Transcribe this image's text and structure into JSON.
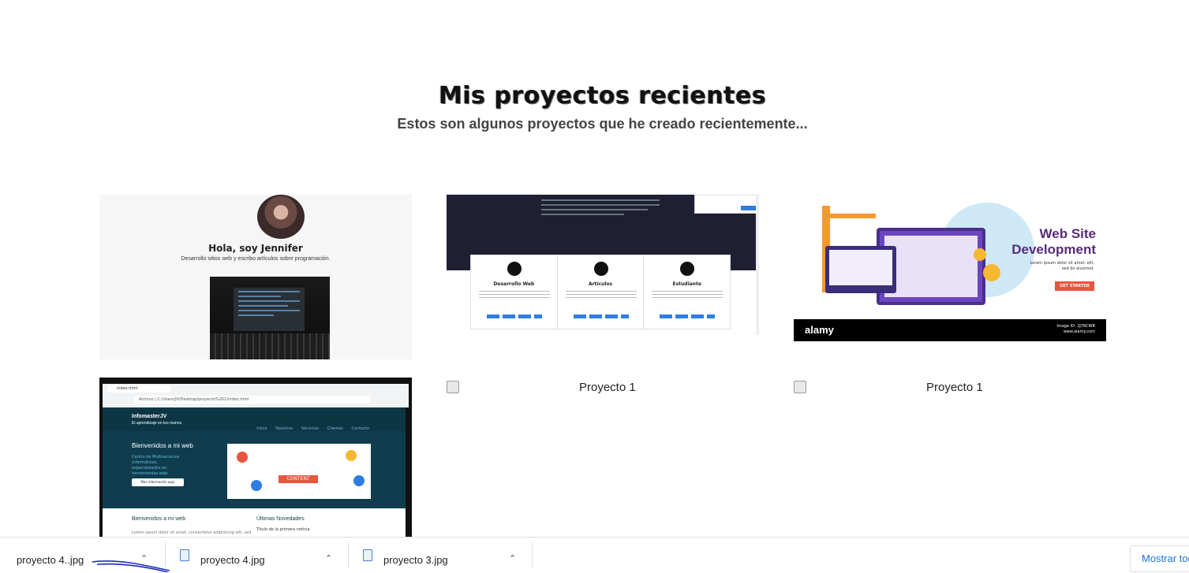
{
  "header": {
    "title": "Mis proyectos recientes",
    "subtitle": "Estos son algunos proyectos que he creado recientemente..."
  },
  "projects": [
    {
      "name": "project-1",
      "heading": "Hola, soy Jennifer",
      "text": "Desarrollo sitios web y escribo artículos sobre programación."
    },
    {
      "name": "project-2",
      "columns": [
        "Desarrollo Web",
        "Artículos",
        "Estudiante"
      ]
    },
    {
      "name": "project-3",
      "headline_1": "Web Site",
      "headline_2": "Development",
      "lorem": "Lorem ipsum dolor sit amet, elit, sed do eiusmod.",
      "cta": "GET STARTED",
      "brand": "alamy",
      "image_id": "Image ID: 2J7KCWR",
      "site": "www.alamy.com"
    },
    {
      "name": "project-4",
      "tab": "index.html",
      "address": "Archivo | C:/Users/JV/Desktop/proyecto%201/index.html",
      "brand": "InfomasterJV",
      "tagline": "El aprendizaje en tus manos",
      "nav": "Inicio Nosotros Servicios Clientes Contacto",
      "welcome": "Bienvenidos a mi web",
      "welcome_text": "Centro de Multiservicios informáticos, especializados en herramientas web",
      "button": "Mas información aqui",
      "content_label": "CONTENT",
      "lower_left": "Bienvenidos a mi web",
      "lower_right": "Últimas Novedades",
      "lower_left_text": "Lorem ipsum dolor sit amet, consectetur adipisicing elit, sed",
      "lower_right_text": "Título de la primera noticia"
    },
    {
      "name": "project-5",
      "alt": "Proyecto 1"
    },
    {
      "name": "project-6",
      "alt": "Proyecto 1"
    }
  ],
  "downloads": {
    "items": [
      {
        "filename": "proyecto 4..jpg"
      },
      {
        "filename": "proyecto 4.jpg"
      },
      {
        "filename": "proyecto 3.jpg"
      }
    ],
    "show_all": "Mostrar todo"
  },
  "colors": {
    "accent": "#1a73e8",
    "card4_bg": "#0f3d4e",
    "wsd_purple": "#5a2a7a"
  }
}
